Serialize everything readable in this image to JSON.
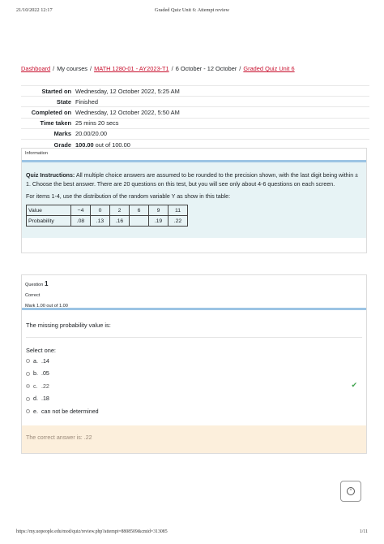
{
  "print_header": {
    "datetime": "21/10/2022 12:17",
    "title": "Graded Quiz Unit 6: Attempt review"
  },
  "breadcrumb": {
    "items": [
      "Dashboard",
      "My courses",
      "MATH 1280-01 - AY2023-T1",
      "6 October - 12 October",
      "Graded Quiz Unit 6"
    ],
    "separator": "/"
  },
  "summary": {
    "rows": [
      {
        "key": "Started on",
        "value": "Wednesday, 12 October 2022, 5:25 AM"
      },
      {
        "key": "State",
        "value": "Finished"
      },
      {
        "key": "Completed on",
        "value": "Wednesday, 12 October 2022, 5:50 AM"
      },
      {
        "key": "Time taken",
        "value": "25 mins 20 secs"
      },
      {
        "key": "Marks",
        "value": "20.00/20.00"
      },
      {
        "key": "Grade",
        "value_bold": "100.00",
        "value_rest": " out of 100.00"
      }
    ]
  },
  "information": {
    "label": "Information",
    "instructions_label": "Quiz Instructions:",
    "instructions_text": " All multiple choice answers are assumed to be rounded to the precision shown, with the last digit being within ± 1. Choose the best answer. There are 20 questions on this test, but you will see only about 4-6 questions on each screen.",
    "table_intro": "For items 1-4, use the distribution of the random variable Y as show in this table:",
    "table": {
      "row1_label": "Value",
      "row1": [
        "−4",
        "0",
        "2",
        "6",
        "9",
        "11"
      ],
      "row2_label": "Probability",
      "row2": [
        ".08",
        ".13",
        ".16",
        "",
        ".19",
        ".22"
      ]
    }
  },
  "question": {
    "label": "Question",
    "number": "1",
    "status": "Correct",
    "mark": "Mark 1.00 out of 1.00",
    "text": "The missing probability value is:",
    "select_one": "Select one:",
    "options": [
      {
        "letter": "a.",
        "text": ".14"
      },
      {
        "letter": "b.",
        "text": ".05"
      },
      {
        "letter": "c.",
        "text": ".22"
      },
      {
        "letter": "d.",
        "text": ".18"
      },
      {
        "letter": "e.",
        "text": "can not be determined"
      }
    ],
    "selected_index": 2,
    "correct_answer_text": "The correct answer is: .22",
    "correct_color": "#3fa34d"
  },
  "colors": {
    "link": "#c8102e",
    "info_bg": "#e7f3f5",
    "bar": "#9cc4e4",
    "feedback_bg": "#fcefdc"
  },
  "print_footer": {
    "url": "https://my.uopeople.edu/mod/quiz/review.php?attempt=8808509&cmid=313085",
    "page": "1/11"
  }
}
